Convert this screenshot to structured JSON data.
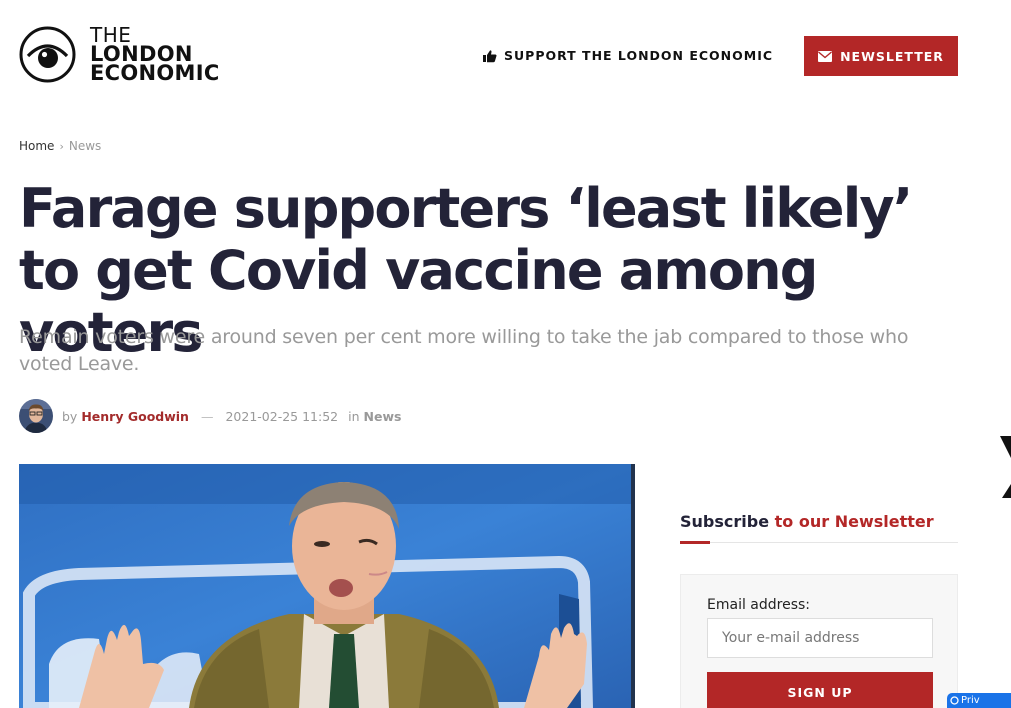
{
  "site": {
    "logo_line1": "THE",
    "logo_line2": "LONDON",
    "logo_line3": "ECONOMIC",
    "logo_icon": "eye-icon"
  },
  "header": {
    "support_label": "SUPPORT THE LONDON ECONOMIC",
    "support_icon": "thumbs-up-icon",
    "newsletter_label": "NEWSLETTER",
    "newsletter_icon": "envelope-icon"
  },
  "breadcrumb": {
    "home": "Home",
    "separator": "›",
    "current": "News"
  },
  "article": {
    "title": "Farage supporters ‘least likely’ to get Covid vaccine among voters",
    "subtitle": "Remain voters were around seven per cent more willing to take the jab compared to those who voted Leave.",
    "meta": {
      "by": "by",
      "author": "Henry Goodwin",
      "dash": "—",
      "date": "2021-02-25 11:52",
      "in": "in",
      "category": "News"
    }
  },
  "sidebar": {
    "widget_title_part1": "Subscribe",
    "widget_title_part2": "to our Newsletter",
    "email_label": "Email address:",
    "email_placeholder": "Your e-mail address",
    "email_value": "",
    "signup_label": "SIGN UP"
  },
  "privacy_badge": "Priv",
  "colors": {
    "accent": "#b32727",
    "title": "#232338",
    "muted": "#999999",
    "privacy_blue": "#1a73e8"
  }
}
